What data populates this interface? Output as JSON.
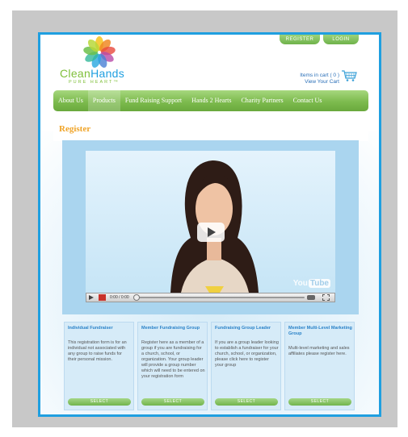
{
  "brand": {
    "name_part1": "Clean",
    "name_part2": "Hands",
    "tagline": "PURE HEART™"
  },
  "header": {
    "register_label": "REGISTER",
    "login_label": "LOGIN"
  },
  "cart": {
    "items_text": "Items in cart ( 0 )",
    "view_text": "View Your Cart"
  },
  "nav": {
    "items": [
      "About Us",
      "Products",
      "Fund Raising Support",
      "Hands 2 Hearts",
      "Charity Partners",
      "Contact Us"
    ]
  },
  "page": {
    "title": "Register"
  },
  "video": {
    "time": "0:00 / 0:00",
    "provider_you": "You",
    "provider_tube": "Tube"
  },
  "cards": [
    {
      "title": "Individual Fundraiser",
      "body": "This registration form is for an individual not associated with any group to raise funds for their personal mission.",
      "button": "SELECT"
    },
    {
      "title": "Member Fundraising Group",
      "body": "Register here as a member of a group if you are fundraising for a church, school, or organization. Your group leader will provide a group number which will need to be entered on your registration form",
      "button": "SELECT"
    },
    {
      "title": "Fundraising Group Leader",
      "body": "If you are a group leader looking to establish a fundraiser for your church, school, or organization, please click here to register your group",
      "button": "SELECT"
    },
    {
      "title": "Member Multi-Level Marketing Group",
      "body": "Multi-level marketing and sales affiliates please register here.",
      "button": "SELECT"
    }
  ],
  "colors": {
    "frame": "#1f9fe0",
    "nav_green": "#7dbb4e",
    "title_orange": "#f0a428",
    "card_bg": "#d6ebf8"
  }
}
